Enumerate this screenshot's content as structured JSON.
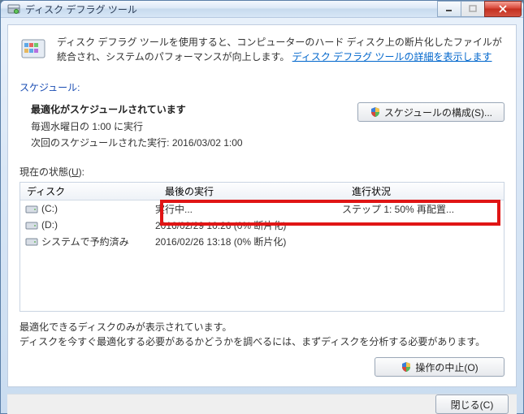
{
  "window": {
    "title": "ディスク デフラグ ツール"
  },
  "intro": {
    "text_part1": "ディスク デフラグ ツールを使用すると、コンピューターのハード ディスク上の断片化したファイルが統合され、システムのパフォーマンスが向上します。",
    "link": "ディスク デフラグ ツールの詳細を表示します"
  },
  "schedule": {
    "section_label": "スケジュール:",
    "title": "最適化がスケジュールされています",
    "line1": "毎週水曜日の 1:00 に実行",
    "line2": "次回のスケジュールされた実行: 2016/03/02 1:00",
    "config_button": "スケジュールの構成(S)..."
  },
  "status": {
    "label_prefix": "現在の状態(",
    "label_uline": "U",
    "label_suffix": "):"
  },
  "list": {
    "headers": {
      "disk": "ディスク",
      "last": "最後の実行",
      "prog": "進行状況"
    },
    "rows": [
      {
        "icon": "drive",
        "name": "(C:)",
        "last": "実行中...",
        "prog": "ステップ 1: 50% 再配置..."
      },
      {
        "icon": "drive",
        "name": "(D:)",
        "last": "2016/02/29 10:26 (0% 断片化)",
        "prog": ""
      },
      {
        "icon": "drive",
        "name": "システムで予約済み",
        "last": "2016/02/26 13:18 (0% 断片化)",
        "prog": ""
      }
    ]
  },
  "hint": {
    "line1": "最適化できるディスクのみが表示されています。",
    "line2": "ディスクを今すぐ最適化する必要があるかどうかを調べるには、まずディスクを分析する必要があります。"
  },
  "actions": {
    "stop_button": "操作の中止(O)"
  },
  "footer": {
    "close_button": "閉じる(C)"
  },
  "colors": {
    "link": "#0066cc",
    "section": "#1a4db3",
    "highlight": "#e01515"
  }
}
